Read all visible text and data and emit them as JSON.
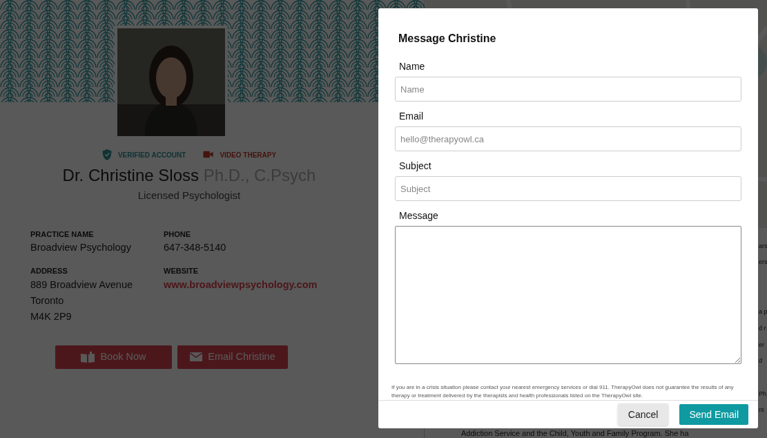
{
  "profile": {
    "badges": [
      {
        "label": "VERIFIED ACCOUNT",
        "kind": "verified"
      },
      {
        "label": "VIDEO THERAPY",
        "kind": "video"
      }
    ],
    "name": "Dr. Christine Sloss",
    "credentials": "Ph.D., C.Psych",
    "title": "Licensed Psychologist",
    "details": [
      {
        "label": "PRACTICE NAME",
        "lines": [
          "Broadview Psychology"
        ],
        "kind": "text"
      },
      {
        "label": "PHONE",
        "lines": [
          "647-348-5140"
        ],
        "kind": "text"
      },
      {
        "label": "ADDRESS",
        "lines": [
          "889 Broadview Avenue",
          "Toronto",
          "M4K 2P9"
        ],
        "kind": "text"
      },
      {
        "label": "WEBSITE",
        "lines": [
          "www.broadviewpsychology.com"
        ],
        "kind": "link"
      }
    ],
    "buttons": [
      {
        "label": "Book Now",
        "kind": "book"
      },
      {
        "label": "Email Christine",
        "kind": "email"
      }
    ]
  },
  "background_text": {
    "fragments": [
      "ars",
      "ers",
      "a p",
      "d r",
      "er",
      "d",
      "Ph",
      "nt"
    ],
    "bottom_line": "Addiction Service and the Child, Youth and Family Program. She ha"
  },
  "modal": {
    "title": "Message Christine",
    "fields": [
      {
        "label": "Name",
        "kind": "input",
        "placeholder": "Name"
      },
      {
        "label": "Email",
        "kind": "input",
        "placeholder": "hello@therapyowl.ca"
      },
      {
        "label": "Subject",
        "kind": "input",
        "placeholder": "Subject"
      },
      {
        "label": "Message",
        "kind": "textarea"
      }
    ],
    "disclaimer": "If you are in a crisis situation please contact your nearest emergency services or dial 911. TherapyOwl does not guarantee the results of any therapy or treatment delivered by the therapists and health professionals listed on the TherapyOwl site.",
    "buttons": [
      {
        "label": "Cancel",
        "kind": "secondary"
      },
      {
        "label": "Send Email",
        "kind": "primary"
      }
    ]
  }
}
